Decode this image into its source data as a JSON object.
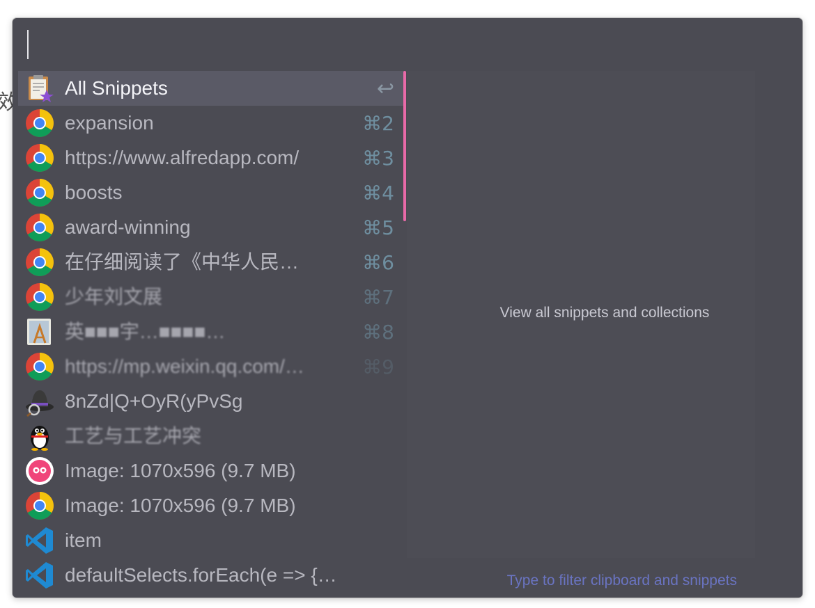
{
  "background": {
    "glyph": "效"
  },
  "search": {
    "value": "",
    "placeholder": ""
  },
  "results": [
    {
      "title": "All Snippets",
      "shortcut": "↩",
      "icon": "clipboard-star-icon",
      "selected": true
    },
    {
      "title": "expansion",
      "shortcut": "⌘2",
      "icon": "chrome-icon"
    },
    {
      "title": "https://www.alfredapp.com/",
      "shortcut": "⌘3",
      "icon": "chrome-icon"
    },
    {
      "title": "boosts",
      "shortcut": "⌘4",
      "icon": "chrome-icon"
    },
    {
      "title": "award-winning",
      "shortcut": "⌘5",
      "icon": "chrome-icon"
    },
    {
      "title": "在仔细阅读了《中华人民…",
      "shortcut": "⌘6",
      "icon": "chrome-icon"
    },
    {
      "title": "少年刘文展",
      "shortcut": "⌘7",
      "icon": "chrome-icon"
    },
    {
      "title": "英■■■宇…■■■■…",
      "shortcut": "⌘8",
      "icon": "xcode-instruments-icon"
    },
    {
      "title": "https://mp.weixin.qq.com/…",
      "shortcut": "⌘9",
      "icon": "chrome-icon"
    },
    {
      "title": "8nZd|Q+OyR(yPvSg",
      "shortcut": "",
      "icon": "alfred-hat-icon"
    },
    {
      "title": "工艺与工艺冲突",
      "shortcut": "",
      "icon": "qq-penguin-icon"
    },
    {
      "title": "Image: 1070x596 (9.7 MB)",
      "shortcut": "",
      "icon": "owl-app-icon"
    },
    {
      "title": "Image: 1070x596 (9.7 MB)",
      "shortcut": "",
      "icon": "chrome-icon"
    },
    {
      "title": "item",
      "shortcut": "",
      "icon": "vscode-icon"
    },
    {
      "title": "defaultSelects.forEach(e => {…",
      "shortcut": "",
      "icon": "vscode-icon"
    }
  ],
  "preview": {
    "text": "View all snippets and collections"
  },
  "footer": {
    "hint": "Type to filter clipboard and snippets"
  },
  "colors": {
    "panel": "#4b4b53",
    "selected": "#5a5a66",
    "scrollbar": "#e86aa8",
    "hint": "#6a74c2"
  }
}
